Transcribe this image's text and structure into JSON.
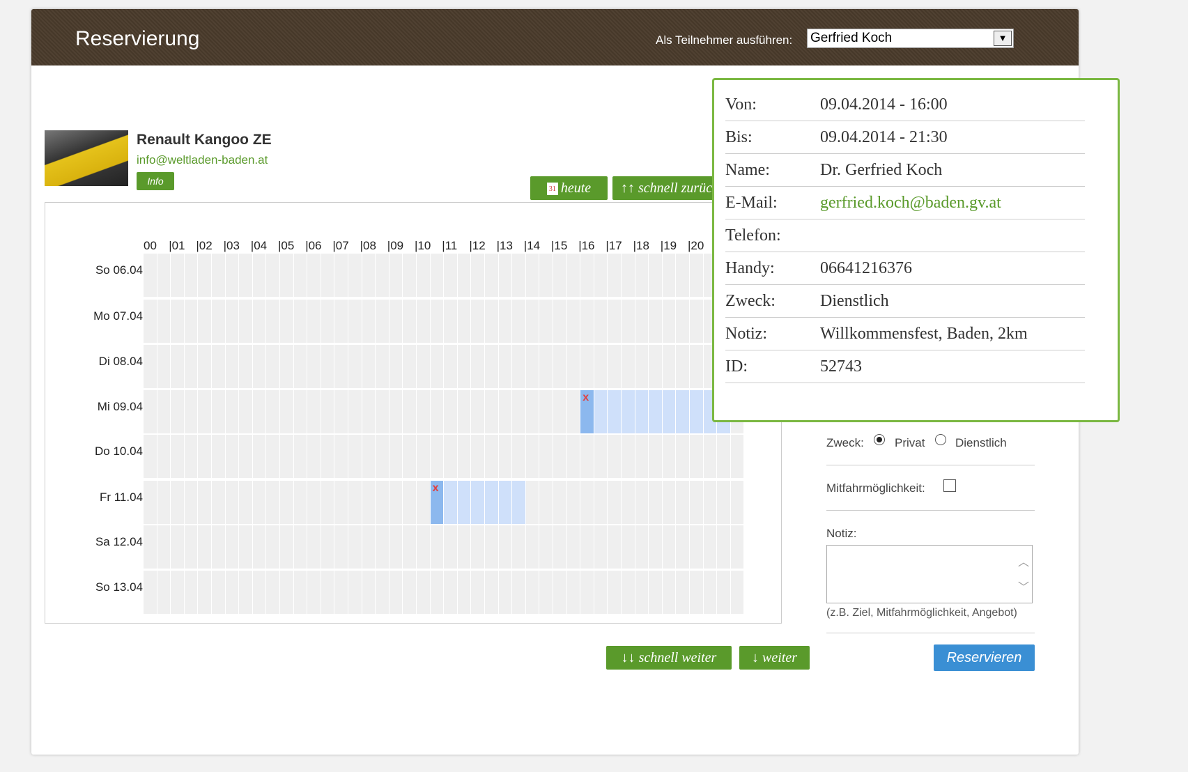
{
  "header": {
    "title": "Reservierung",
    "participant_label": "Als Teilnehmer ausführen:",
    "participant_value": "Gerfried Koch"
  },
  "vehicle": {
    "name": "Renault Kangoo ZE",
    "email": "info@weltladen-baden.at",
    "info_label": "Info"
  },
  "nav": {
    "today_label": "heute",
    "fast_back_label": "↑↑ schnell zurück",
    "fast_forward_label": "↓↓ schnell weiter",
    "forward_label": "↓ weiter"
  },
  "grid": {
    "hours": [
      "00",
      "|01",
      "|02",
      "|03",
      "|04",
      "|05",
      "|06",
      "|07",
      "|08",
      "|09",
      "|10",
      "|11",
      "|12",
      "|13",
      "|14",
      "|15",
      "|16",
      "|17",
      "|18",
      "|19",
      "|20"
    ],
    "days": [
      "So 06.04",
      "Mo 07.04",
      "Di 08.04",
      "Mi 09.04",
      "Do 10.04",
      "Fr 11.04",
      "Sa 12.04",
      "So 13.04"
    ],
    "reservations": [
      {
        "day": "Mi 09.04",
        "from": "16:00",
        "to": "21:30"
      },
      {
        "day": "Fr 11.04",
        "from": "10:30",
        "to": "14:00"
      }
    ],
    "cancel_mark": "x"
  },
  "form": {
    "purpose_label": "Zweck:",
    "purpose_private": "Privat",
    "purpose_business": "Dienstlich",
    "purpose_selected": "Privat",
    "ride_share_label": "Mitfahrmöglichkeit:",
    "ride_share_checked": false,
    "note_label": "Notiz:",
    "note_value": "",
    "note_hint": "(z.B. Ziel, Mitfahrmöglichkeit, Angebot)",
    "reserve_label": "Reservieren"
  },
  "popup": {
    "rows": [
      {
        "key": "Von:",
        "value": "09.04.2014 - 16:00"
      },
      {
        "key": "Bis:",
        "value": "09.04.2014 - 21:30"
      },
      {
        "key": "Name:",
        "value": "Dr. Gerfried Koch"
      },
      {
        "key": "E-Mail:",
        "value": "gerfried.koch@baden.gv.at"
      },
      {
        "key": "Telefon:",
        "value": ""
      },
      {
        "key": "Handy:",
        "value": "06641216376"
      },
      {
        "key": "Zweck:",
        "value": "Dienstlich"
      },
      {
        "key": "Notiz:",
        "value": "Willkommensfest, Baden, 2km"
      },
      {
        "key": "ID:",
        "value": "52743"
      }
    ]
  },
  "colors": {
    "header_bg": "#4a3b2b",
    "accent_green": "#5a9a2b",
    "reserve_blue": "#3a8fd4",
    "reserved_cell": "#cfe0fa",
    "reserved_start_cell": "#8cb8ee",
    "popup_border": "#7bb842"
  }
}
